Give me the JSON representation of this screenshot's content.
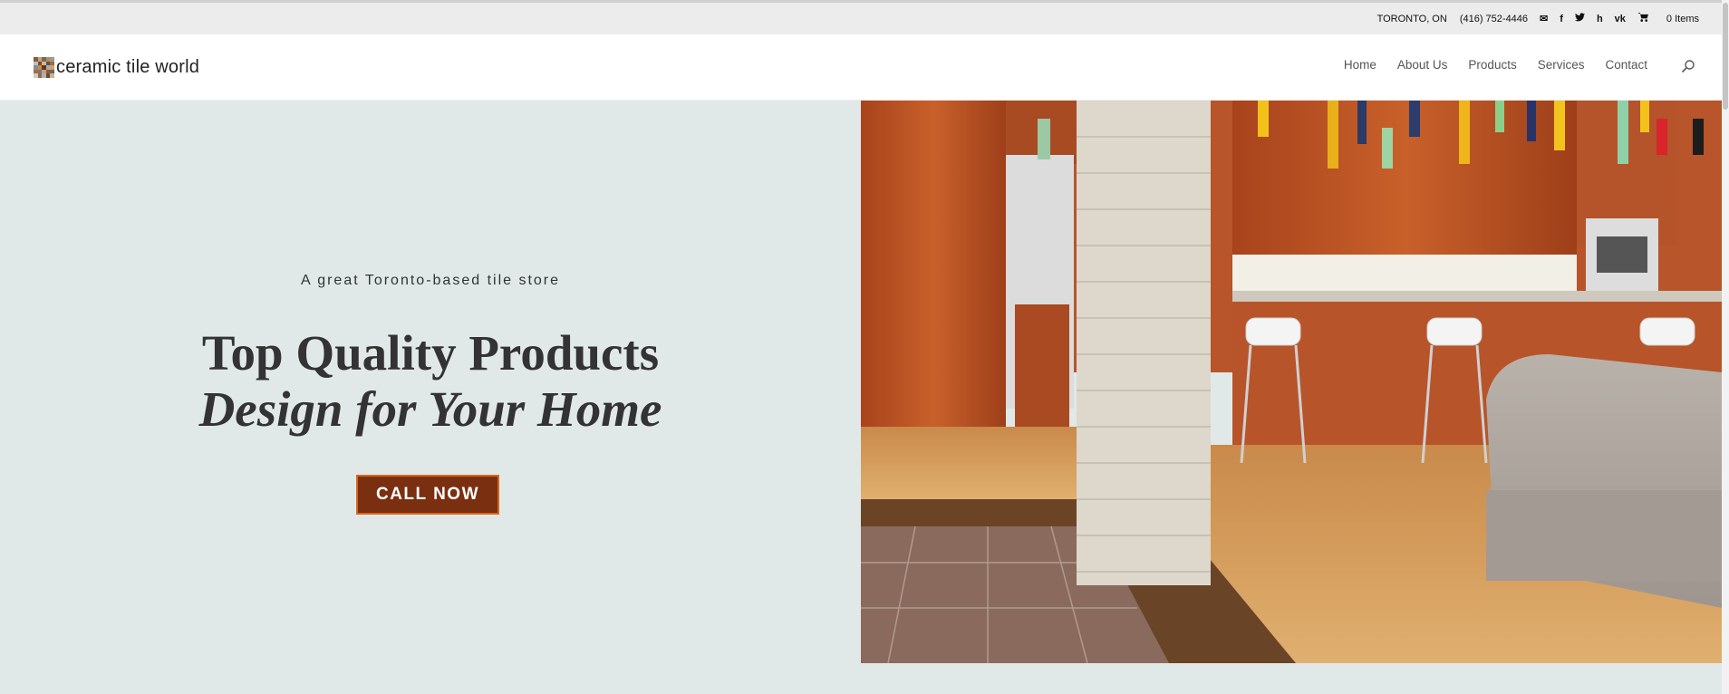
{
  "topbar": {
    "location": "TORONTO, ON",
    "phone": "(416) 752-4446",
    "icons": [
      "email-icon",
      "facebook-icon",
      "twitter-icon",
      "houzz-icon",
      "vk-icon"
    ],
    "cart_label": "0 Items"
  },
  "header": {
    "logo_text": "ceramic tile world",
    "nav": [
      "Home",
      "About Us",
      "Products",
      "Services",
      "Contact"
    ]
  },
  "hero": {
    "tagline": "A great Toronto-based tile store",
    "title_line1": "Top Quality Products",
    "title_line2": "Design for Your Home",
    "cta_label": "CALL NOW",
    "slides_count": 2,
    "active_slide": 1
  },
  "colors": {
    "background": "#e1e9e8",
    "cta_fill": "#7a2f10",
    "cta_border": "#d8661c",
    "text_dark": "#333333"
  }
}
